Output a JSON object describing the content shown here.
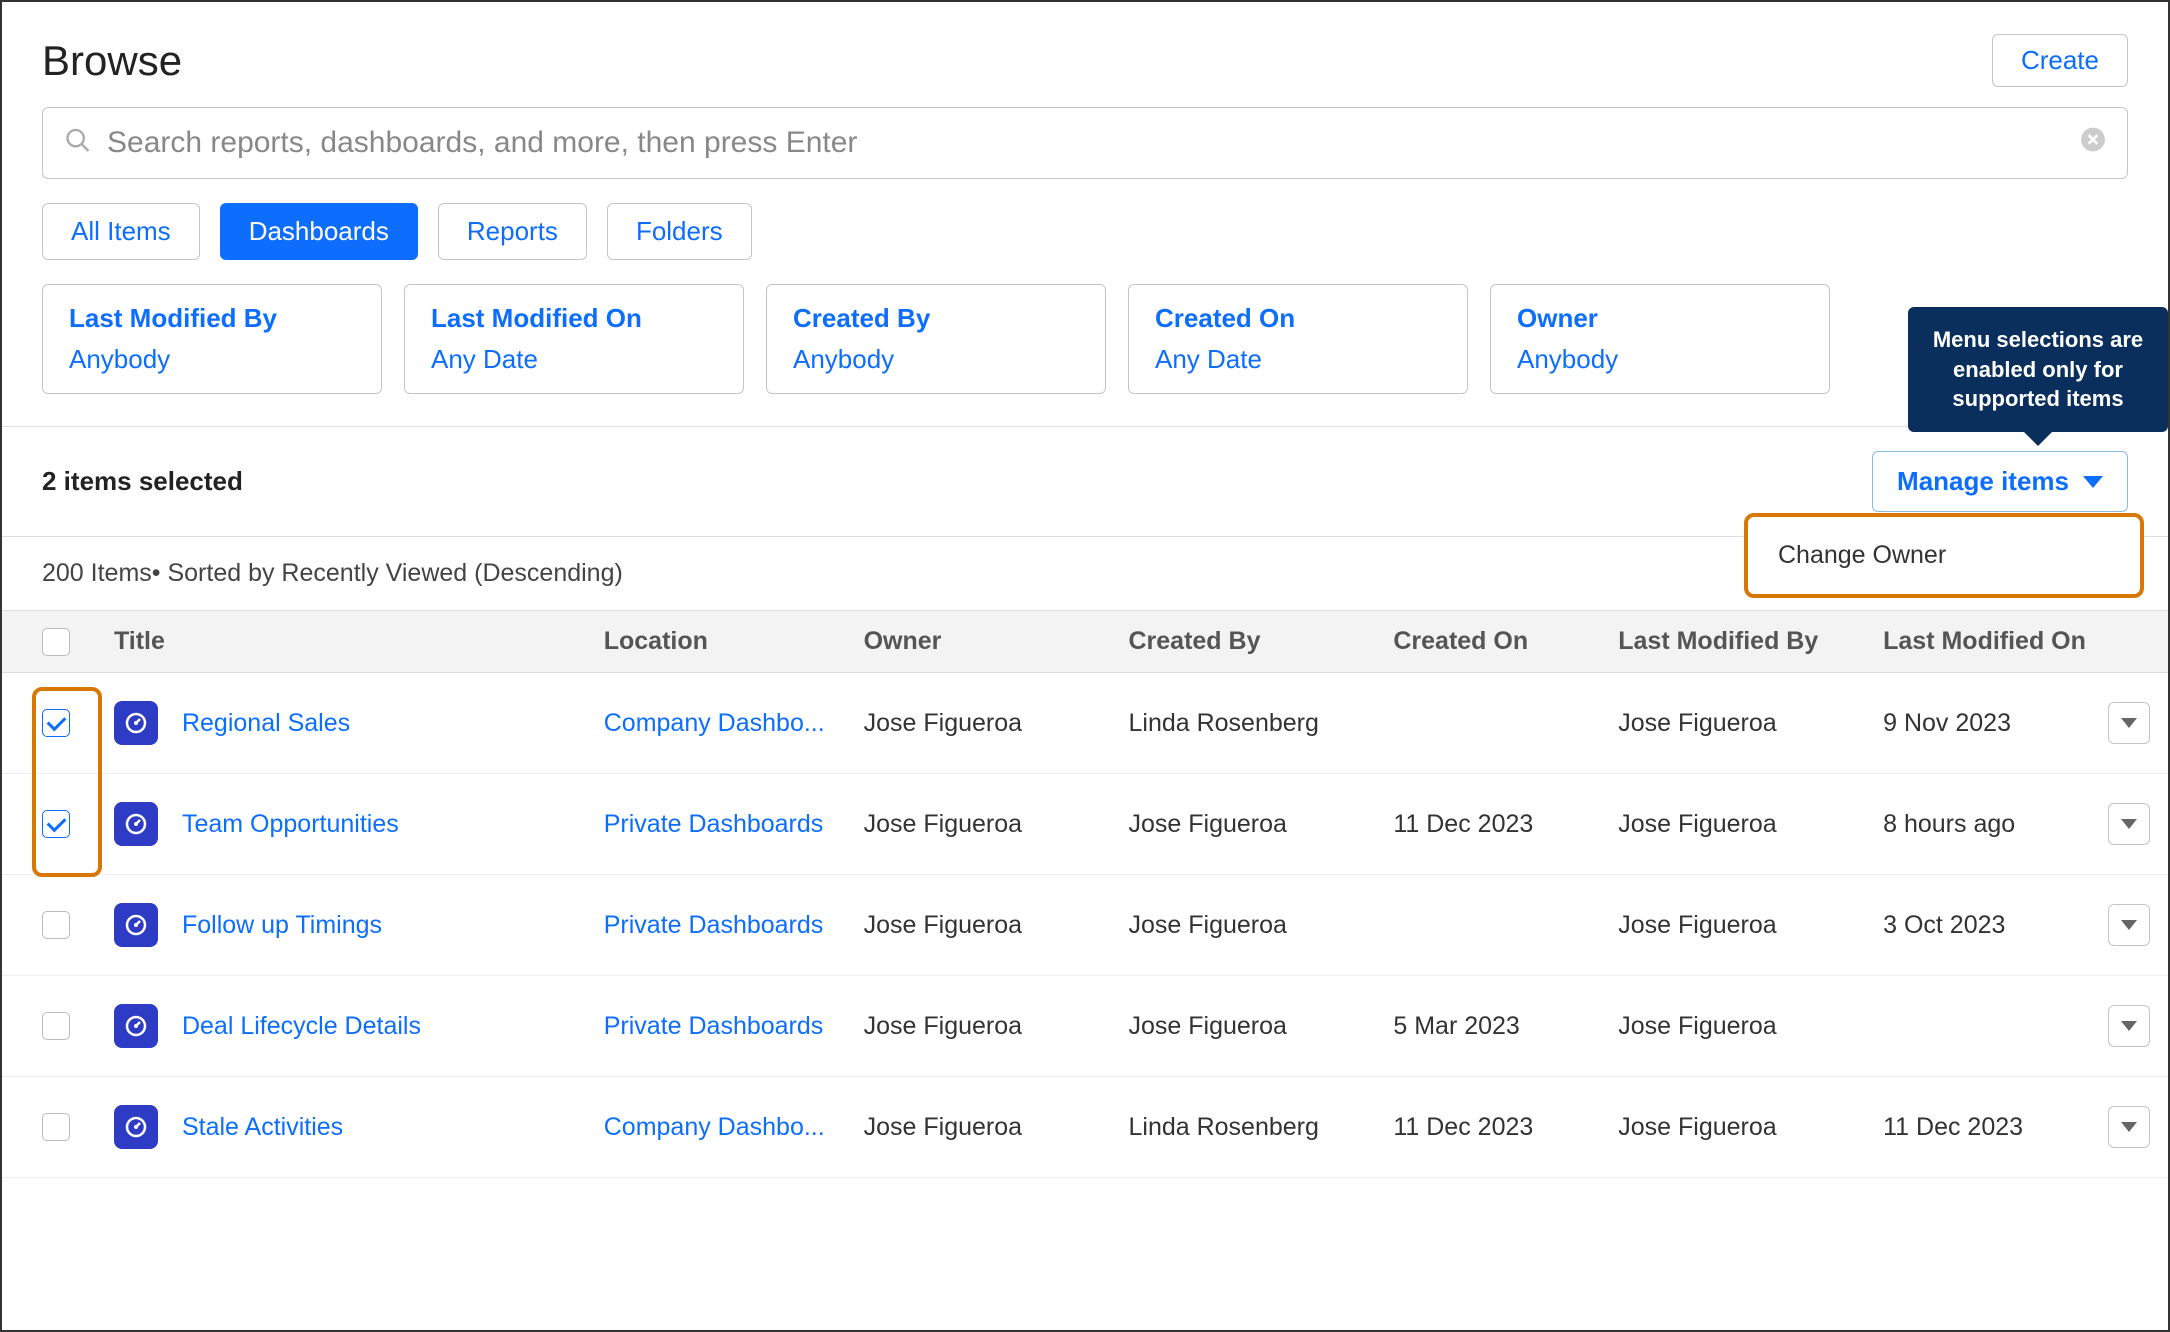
{
  "header": {
    "title": "Browse",
    "create_label": "Create"
  },
  "search": {
    "placeholder": "Search reports, dashboards, and more, then press Enter"
  },
  "tabs": [
    {
      "label": "All Items",
      "active": false
    },
    {
      "label": "Dashboards",
      "active": true
    },
    {
      "label": "Reports",
      "active": false
    },
    {
      "label": "Folders",
      "active": false
    }
  ],
  "filters": [
    {
      "label": "Last Modified By",
      "value": "Anybody"
    },
    {
      "label": "Last Modified On",
      "value": "Any Date"
    },
    {
      "label": "Created By",
      "value": "Anybody"
    },
    {
      "label": "Created On",
      "value": "Any Date"
    },
    {
      "label": "Owner",
      "value": "Anybody"
    }
  ],
  "selection": {
    "text": "2 items selected",
    "manage_label": "Manage items",
    "tooltip": "Menu selections are enabled only for supported items",
    "menu_option": "Change Owner"
  },
  "sort_text": "200 Items• Sorted by Recently Viewed (Descending)",
  "columns": {
    "title": "Title",
    "location": "Location",
    "owner": "Owner",
    "created_by": "Created By",
    "created_on": "Created On",
    "modified_by": "Last Modified By",
    "modified_on": "Last Modified On"
  },
  "rows": [
    {
      "checked": true,
      "title": "Regional Sales",
      "location": "Company Dashbo...",
      "owner": "Jose Figueroa",
      "created_by": "Linda Rosenberg",
      "created_on": "",
      "modified_by": "Jose Figueroa",
      "modified_on": "9 Nov 2023"
    },
    {
      "checked": true,
      "title": "Team Opportunities",
      "location": "Private Dashboards",
      "owner": "Jose Figueroa",
      "created_by": "Jose Figueroa",
      "created_on": "11 Dec 2023",
      "modified_by": "Jose Figueroa",
      "modified_on": "8 hours ago"
    },
    {
      "checked": false,
      "title": "Follow up Timings",
      "location": "Private Dashboards",
      "owner": "Jose Figueroa",
      "created_by": "Jose Figueroa",
      "created_on": "",
      "modified_by": "Jose Figueroa",
      "modified_on": "3 Oct 2023"
    },
    {
      "checked": false,
      "title": "Deal Lifecycle Details",
      "location": "Private Dashboards",
      "owner": "Jose Figueroa",
      "created_by": "Jose Figueroa",
      "created_on": "5 Mar 2023",
      "modified_by": "Jose Figueroa",
      "modified_on": ""
    },
    {
      "checked": false,
      "title": "Stale Activities",
      "location": "Company Dashbo...",
      "owner": "Jose Figueroa",
      "created_by": "Linda Rosenberg",
      "created_on": "11 Dec 2023",
      "modified_by": "Jose Figueroa",
      "modified_on": "11 Dec 2023"
    }
  ]
}
